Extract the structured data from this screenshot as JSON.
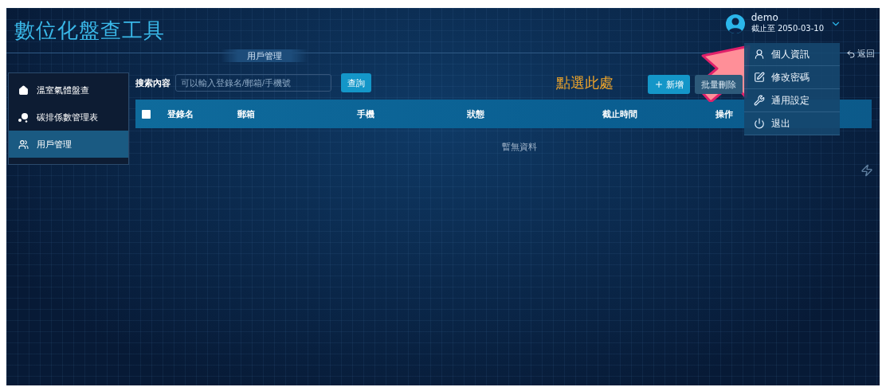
{
  "app_title": "數位化盤查工具",
  "breadcrumb": "用戶管理",
  "user": {
    "name": "demo",
    "expiry": "截止至 2050-03-10"
  },
  "user_menu": [
    {
      "label": "個人資訊"
    },
    {
      "label": "修改密碼"
    },
    {
      "label": "通用設定"
    },
    {
      "label": "退出"
    }
  ],
  "back_button": "返回",
  "sidebar": {
    "items": [
      {
        "label": "溫室氣體盤查",
        "selected": false
      },
      {
        "label": "碳排係數管理表",
        "selected": false
      },
      {
        "label": "用戶管理",
        "selected": true
      }
    ]
  },
  "search": {
    "label": "搜索內容",
    "placeholder": "可以輸入登錄名/郵箱/手機號",
    "button": "查詢"
  },
  "actions": [
    {
      "label": "新增",
      "kind": "primary"
    },
    {
      "label": "批量刪除",
      "kind": "secondary"
    }
  ],
  "table": {
    "select_all_checked": false,
    "columns": [
      "登錄名",
      "郵箱",
      "手機",
      "狀態",
      "截止時間",
      "操作"
    ],
    "empty_text": "暫無資料"
  },
  "annotation": {
    "text": "點選此處"
  }
}
